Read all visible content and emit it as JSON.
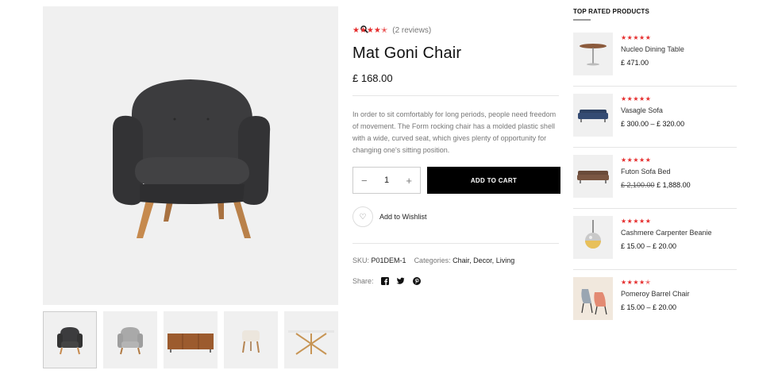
{
  "product": {
    "rating_stars": "★★★★✭",
    "reviews": "(2 reviews)",
    "title": "Mat Goni Chair",
    "price": "£ 168.00",
    "description": "In order to sit comfortably for long periods, people need freedom of movement. The Form rocking chair has a molded plastic shell with a wide, curved seat, which gives plenty of opportunity for changing one's sitting position.",
    "quantity": "1",
    "add_to_cart": "ADD TO CART",
    "wishlist": "Add to Wishlist",
    "sku_label": "SKU:",
    "sku": "P01DEM-1",
    "categories_label": "Categories:",
    "categories": [
      "Chair",
      "Decor",
      "Living"
    ],
    "share_label": "Share:"
  },
  "gallery": {
    "zoom_icon": "search-icon",
    "thumbnails": [
      "dark-armchair",
      "grey-armchair",
      "wooden-sideboard",
      "stool",
      "cross-leg-table"
    ]
  },
  "sidebar": {
    "title": "TOP RATED PRODUCTS",
    "products": [
      {
        "name": "Nucleo Dining Table",
        "stars": "★★★★★",
        "price": "£ 471.00"
      },
      {
        "name": "Vasagle Sofa",
        "stars": "★★★★★",
        "price": "£ 300.00 – £ 320.00"
      },
      {
        "name": "Futon Sofa Bed",
        "stars": "★★★★★",
        "old_price": "£ 2,100.00",
        "price": "£ 1,888.00"
      },
      {
        "name": "Cashmere Carpenter Beanie",
        "stars": "★★★★★",
        "price": "£ 15.00 – £ 20.00"
      },
      {
        "name": "Pomeroy Barrel Chair",
        "stars": "★★★★✭",
        "price": "£ 15.00 – £ 20.00"
      }
    ]
  },
  "colors": {
    "star": "#e52d2d",
    "button": "#000000",
    "image_bg": "#f0f0f0"
  }
}
